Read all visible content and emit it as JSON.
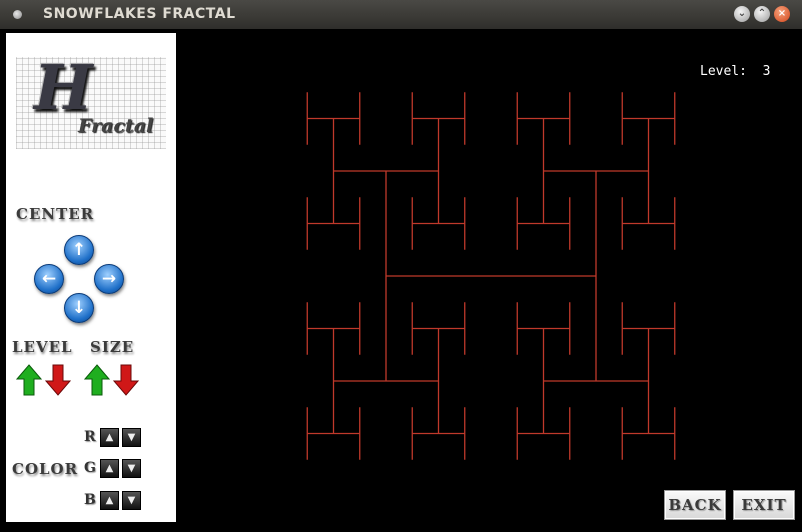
{
  "window": {
    "title": "SNOWFLAKES FRACTAL"
  },
  "sidebar": {
    "logo": {
      "letter": "H",
      "word": "Fractal"
    },
    "center_label": "CENTER",
    "level_label": "LEVEL",
    "size_label": "SIZE",
    "color_label": "COLOR",
    "channels": [
      "R",
      "G",
      "B"
    ]
  },
  "display": {
    "level_text": "Level:  3",
    "level": 3,
    "line_color": "#c0392b"
  },
  "buttons": {
    "back": "BACK",
    "exit": "EXIT"
  },
  "icons": {
    "up": "arrow-up-icon",
    "down": "arrow-down-icon",
    "left": "arrow-left-icon",
    "right": "arrow-right-icon"
  },
  "colors": {
    "titlebar": "#3c3b37",
    "up_green": "#1fae1f",
    "down_red": "#d01818",
    "arrow_blue": "#1e6fc8"
  }
}
